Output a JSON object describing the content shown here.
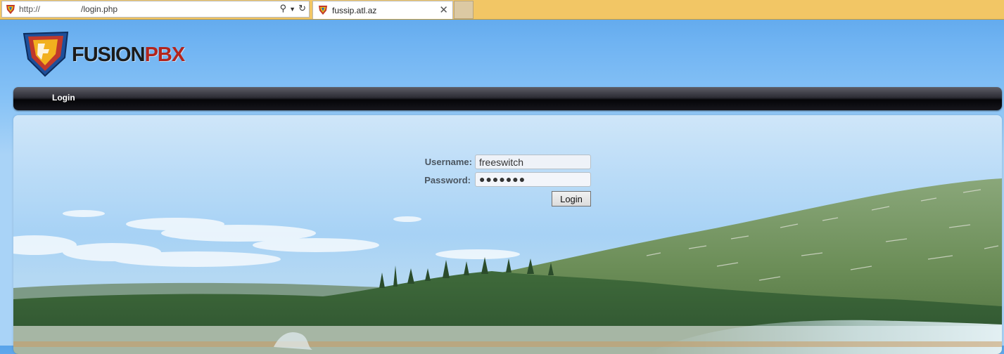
{
  "browser": {
    "address": {
      "scheme": "http://",
      "path": "/login.php"
    },
    "tab": {
      "title": "fussip.atl.az"
    }
  },
  "logo": {
    "word1": "FUSION",
    "word2": "PBX"
  },
  "menu": {
    "items": [
      {
        "label": "Login"
      }
    ]
  },
  "login": {
    "username_label": "Username:",
    "username_value": "freeswitch",
    "password_label": "Password:",
    "password_value": "●●●●●●●",
    "submit_label": "Login"
  }
}
